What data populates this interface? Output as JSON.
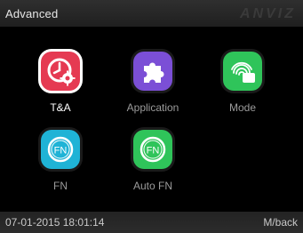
{
  "header": {
    "title": "Advanced",
    "brand": "ANVIZ"
  },
  "menu": {
    "items": [
      {
        "label": "T&A",
        "icon": "clock-gear-icon",
        "color": "#e53a52",
        "selected": true
      },
      {
        "label": "Application",
        "icon": "puzzle-icon",
        "color": "#7b4fd6",
        "selected": false
      },
      {
        "label": "Mode",
        "icon": "fingerprint-card-icon",
        "color": "#2fc45a",
        "selected": false
      },
      {
        "label": "FN",
        "icon": "fn-circle-icon",
        "color": "#1fb3d6",
        "selected": false
      },
      {
        "label": "Auto FN",
        "icon": "fn-circle-icon",
        "color": "#2fc45a",
        "selected": false
      }
    ]
  },
  "footer": {
    "datetime": "07-01-2015 18:01:14",
    "back_label": "M/back"
  }
}
